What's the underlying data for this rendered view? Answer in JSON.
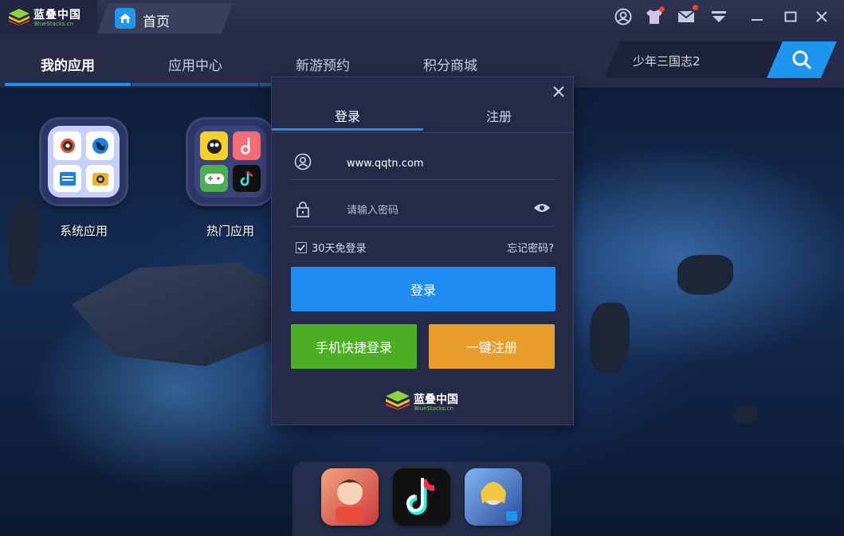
{
  "titlebar": {
    "logo_cn": "蓝叠中国",
    "logo_en": "BlueStacks.cn",
    "home_tab_label": "首页",
    "buttons": [
      "account-icon",
      "theme-icon",
      "mail-icon",
      "menu-icon",
      "minimize-icon",
      "maximize-icon",
      "close-icon"
    ]
  },
  "nav": {
    "tabs": [
      {
        "label": "我的应用",
        "active": true
      },
      {
        "label": "应用中心",
        "active": false
      },
      {
        "label": "新游预约",
        "active": false
      },
      {
        "label": "积分商城",
        "active": false
      }
    ],
    "search_value": "少年三国志2"
  },
  "desktop": {
    "folders": [
      {
        "label": "系统应用",
        "apps": [
          "settings-icon",
          "browser-icon",
          "file-manager-icon",
          "camera-icon"
        ]
      },
      {
        "label": "热门应用",
        "apps": [
          "game-app-icon",
          "music-app-icon",
          "gamepad-app-icon",
          "tiktok-icon"
        ]
      }
    ],
    "dock_apps": [
      "romance-game-icon",
      "tiktok-icon",
      "anime-game-icon"
    ]
  },
  "login_dialog": {
    "tabs": [
      {
        "label": "登录",
        "active": true
      },
      {
        "label": "注册",
        "active": false
      }
    ],
    "username_value": "www.qqtn.com",
    "password_placeholder": "请输入密码",
    "remember_label": "30天免登录",
    "remember_checked": true,
    "forgot_label": "忘记密码?",
    "login_button": "登录",
    "phone_login_button": "手机快捷登录",
    "quick_register_button": "一键注册",
    "footer_logo_cn": "蓝叠中国",
    "footer_logo_en": "BlueStacks.cn"
  },
  "colors": {
    "accent": "#1e8cf0",
    "green": "#4caf23",
    "orange": "#e89d2c",
    "dialog_bg": "#252a48"
  }
}
